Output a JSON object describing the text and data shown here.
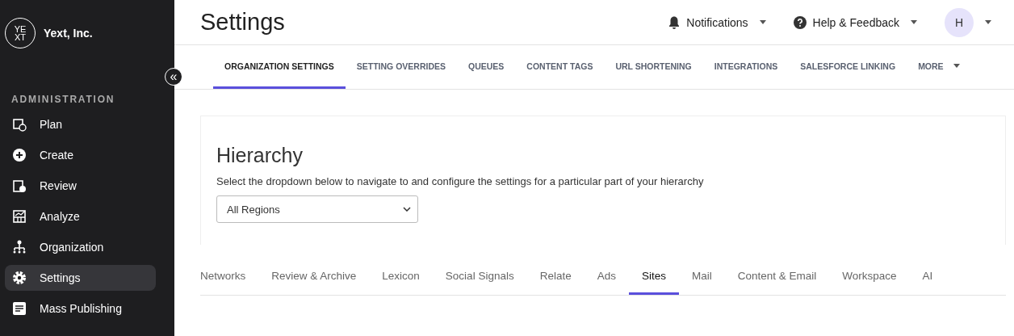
{
  "sidebar": {
    "org_name": "Yext, Inc.",
    "logo_text": "YE XT",
    "collapse_icon": "«",
    "section_title": "ADMINISTRATION",
    "items": [
      {
        "label": "Plan",
        "selected": false
      },
      {
        "label": "Create",
        "selected": false
      },
      {
        "label": "Review",
        "selected": false
      },
      {
        "label": "Analyze",
        "selected": false
      },
      {
        "label": "Organization",
        "selected": false
      },
      {
        "label": "Settings",
        "selected": true
      },
      {
        "label": "Mass Publishing",
        "selected": false
      }
    ]
  },
  "header": {
    "title": "Settings",
    "notifications": "Notifications",
    "help": "Help & Feedback",
    "avatar": "H"
  },
  "tabs": [
    {
      "label": "ORGANIZATION SETTINGS",
      "selected": true
    },
    {
      "label": "SETTING OVERRIDES",
      "selected": false
    },
    {
      "label": "QUEUES",
      "selected": false
    },
    {
      "label": "CONTENT TAGS",
      "selected": false
    },
    {
      "label": "URL SHORTENING",
      "selected": false
    },
    {
      "label": "INTEGRATIONS",
      "selected": false
    },
    {
      "label": "SALESFORCE LINKING",
      "selected": false
    },
    {
      "label": "MORE",
      "selected": false,
      "dropdown": true
    }
  ],
  "hierarchy": {
    "title": "Hierarchy",
    "description": "Select the dropdown below to navigate to and configure the settings for a particular part of your hierarchy",
    "select_value": "All Regions"
  },
  "subtabs": [
    {
      "label": "Networks",
      "selected": false
    },
    {
      "label": "Review & Archive",
      "selected": false
    },
    {
      "label": "Lexicon",
      "selected": false
    },
    {
      "label": "Social Signals",
      "selected": false
    },
    {
      "label": "Relate",
      "selected": false
    },
    {
      "label": "Ads",
      "selected": false
    },
    {
      "label": "Sites",
      "selected": true
    },
    {
      "label": "Mail",
      "selected": false
    },
    {
      "label": "Content & Email",
      "selected": false
    },
    {
      "label": "Workspace",
      "selected": false
    },
    {
      "label": "AI",
      "selected": false
    }
  ]
}
